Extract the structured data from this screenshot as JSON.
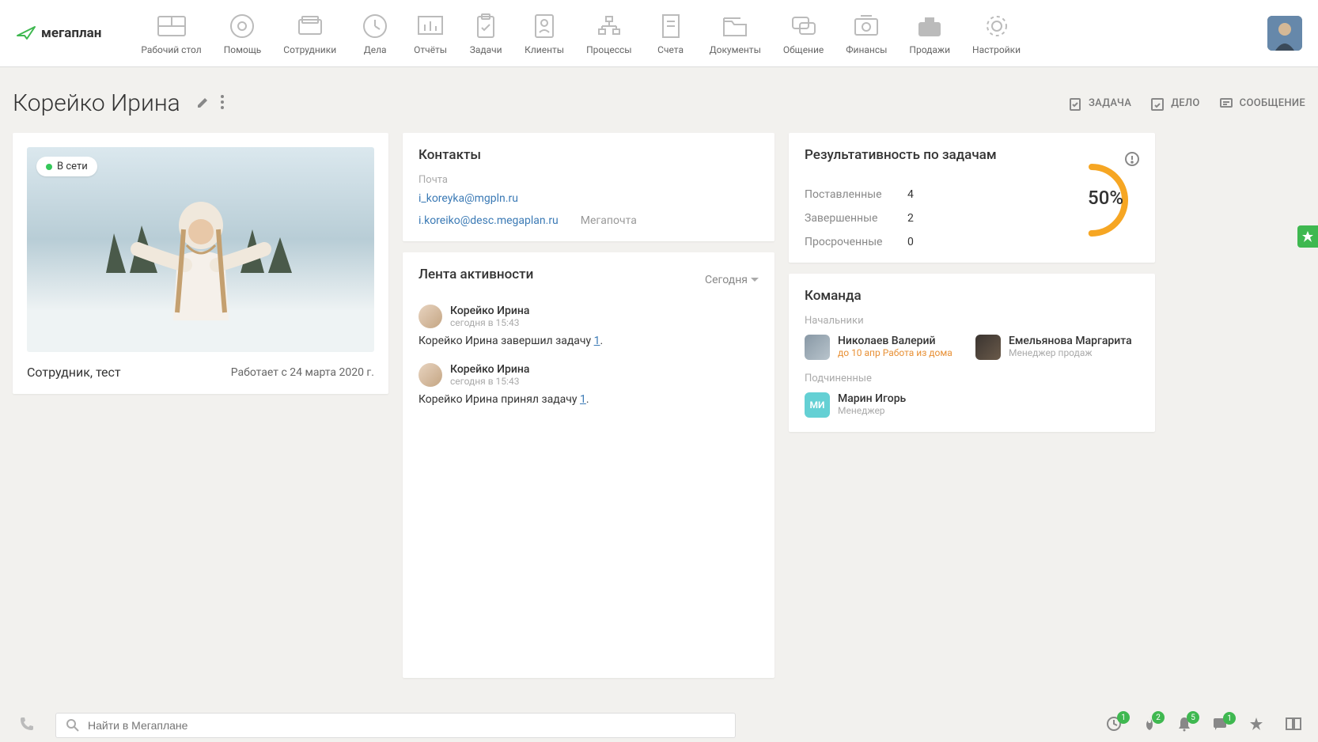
{
  "logo": "мегаплан",
  "nav": [
    {
      "label": "Рабочий стол"
    },
    {
      "label": "Помощь"
    },
    {
      "label": "Сотрудники"
    },
    {
      "label": "Дела"
    },
    {
      "label": "Отчёты"
    },
    {
      "label": "Задачи"
    },
    {
      "label": "Клиенты"
    },
    {
      "label": "Процессы"
    },
    {
      "label": "Счета"
    },
    {
      "label": "Документы"
    },
    {
      "label": "Общение"
    },
    {
      "label": "Финансы"
    },
    {
      "label": "Продажи"
    },
    {
      "label": "Настройки"
    }
  ],
  "title": "Корейко Ирина",
  "hdr_actions": {
    "task": "ЗАДАЧА",
    "deal": "ДЕЛО",
    "message": "СООБЩЕНИЕ"
  },
  "profile": {
    "online": "В сети",
    "role": "Сотрудник, тест",
    "since": "Работает с 24 марта 2020 г."
  },
  "contacts": {
    "title": "Контакты",
    "mail_label": "Почта",
    "email1": "i_koreyka@mgpln.ru",
    "email2": "i.koreiko@desc.megaplan.ru",
    "mega": "Мегапочта"
  },
  "activity": {
    "title": "Лента активности",
    "filter": "Сегодня",
    "items": [
      {
        "name": "Корейко Ирина",
        "time": "сегодня в 15:43",
        "text_pre": "Корейко Ирина завершил задачу ",
        "link": "1",
        "text_post": "."
      },
      {
        "name": "Корейко Ирина",
        "time": "сегодня в 15:43",
        "text_pre": "Корейко Ирина принял задачу ",
        "link": "1",
        "text_post": "."
      }
    ]
  },
  "perf": {
    "title": "Результативность по задачам",
    "rows": [
      {
        "label": "Поставленные",
        "val": "4"
      },
      {
        "label": "Завершенные",
        "val": "2"
      },
      {
        "label": "Просроченные",
        "val": "0"
      }
    ],
    "percent": "50%"
  },
  "team": {
    "title": "Команда",
    "bosses_label": "Начальники",
    "subs_label": "Подчиненные",
    "bosses": [
      {
        "name": "Николаев Валерий",
        "role": "до 10 апр Работа из дома",
        "orange": true
      },
      {
        "name": "Емельянова Маргарита",
        "role": "Менеджер продаж"
      }
    ],
    "subs": [
      {
        "name": "Марин Игорь",
        "role": "Менеджер",
        "initials": "МИ"
      }
    ]
  },
  "search_placeholder": "Найти в Мегаплане",
  "bottom_badges": {
    "clock": "1",
    "fire": "2",
    "bell": "5",
    "chat": "1"
  }
}
